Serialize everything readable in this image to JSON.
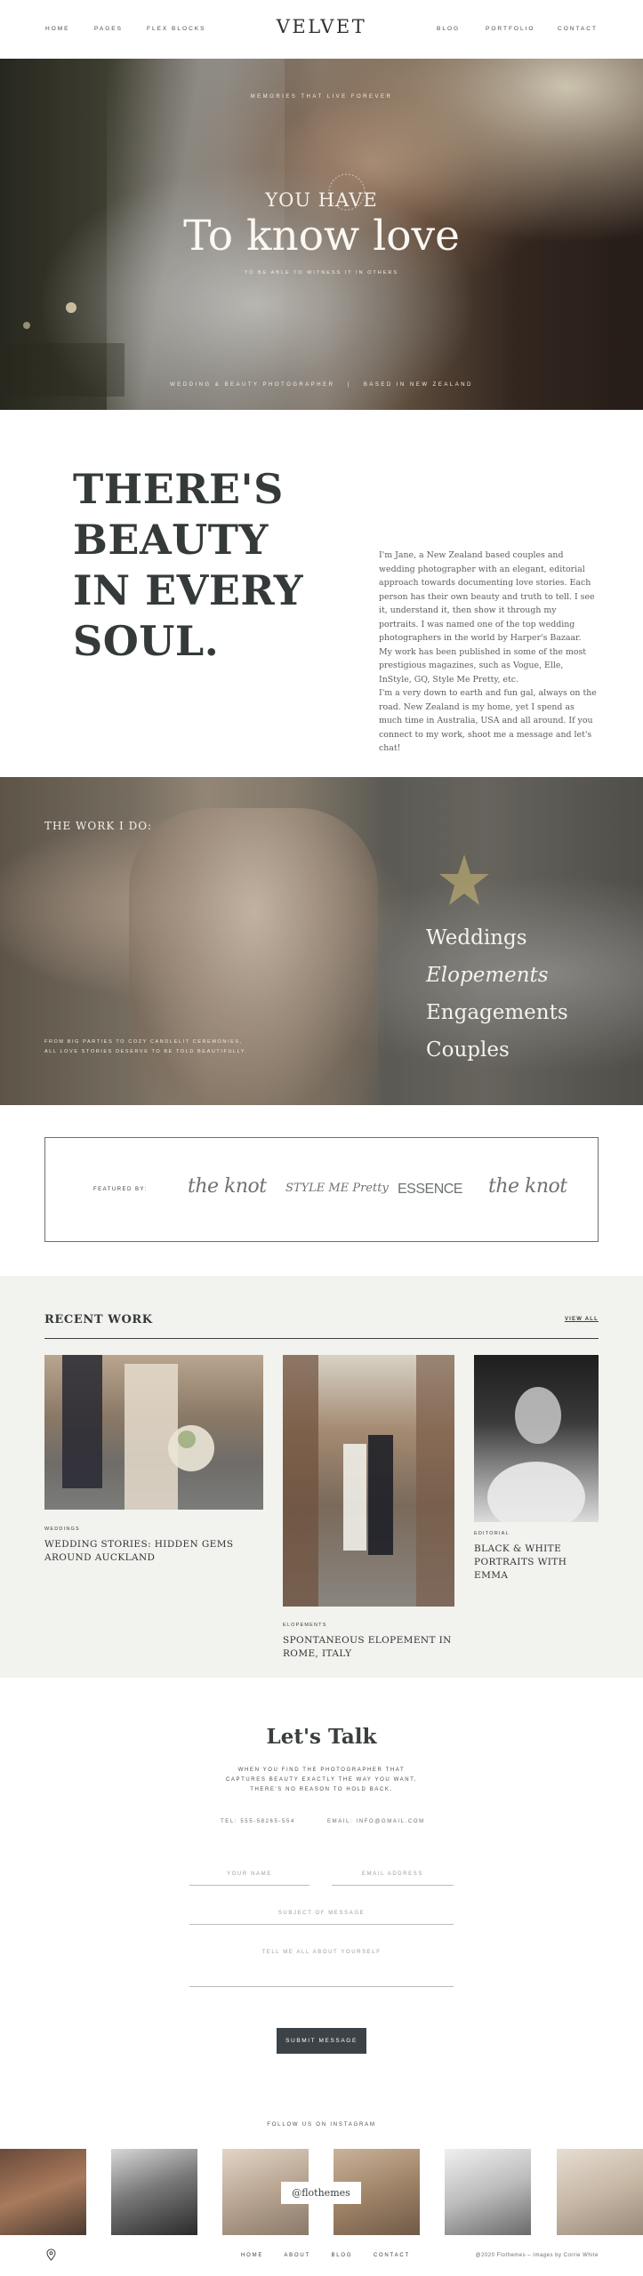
{
  "nav": {
    "left": [
      "HOME",
      "PAGES",
      "FLEX BLOCKS"
    ],
    "brand": "VELVET",
    "right": [
      "BLOG",
      "PORTFOLIO",
      "CONTACT"
    ]
  },
  "hero": {
    "kicker": "MEMORIES THAT LIVE FOREVER",
    "pre_title": "YOU HAVE",
    "title": "To know love",
    "subtitle": "TO BE ABLE TO WITNESS IT IN OTHERS",
    "footer_left": "WEDDING & BEAUTY PHOTOGRAPHER",
    "footer_sep": "|",
    "footer_right": "BASED IN NEW ZEALAND"
  },
  "intro": {
    "heading_lines": [
      "THERE'S",
      "BEAUTY",
      "IN EVERY",
      "SOUL."
    ],
    "paragraphs": [
      "I'm Jane, a New Zealand based couples and wedding photographer with an elegant, editorial approach towards documenting love stories. Each person has their own beauty and truth to tell. I see it, understand it, then show it through my portraits. I was named one of the top wedding photographers in the world by Harper's Bazaar. My work has been published in some of the most prestigious magazines, such as Vogue, Elle, InStyle, GQ, Style Me Pretty, etc.",
      "I'm a very down to earth and fun gal, always on the road. New Zealand is my home, yet I spend as much time in Australia, USA and all around. If you connect to my work, shoot me a message and let's chat!"
    ]
  },
  "work": {
    "title": "THE WORK I DO:",
    "services": [
      "Weddings",
      "Elopements",
      "Engagements",
      "Couples"
    ],
    "active_service": "Elopements",
    "footer_lines": [
      "FROM BIG PARTIES TO COZY CANDLELIT CEREMONIES,",
      "ALL LOVE STORIES DESERVE TO BE TOLD BEAUTIFULLY."
    ]
  },
  "featured": {
    "label": "FEATURED BY:",
    "logos": [
      "the knot",
      "STYLE ME Pretty",
      "ESSENCE",
      "the knot"
    ]
  },
  "recent": {
    "title": "RECENT WORK",
    "view_all": "VIEW ALL",
    "cards": [
      {
        "category": "WEDDINGS",
        "title": "WEDDING STORIES: HIDDEN GEMS AROUND AUCKLAND"
      },
      {
        "category": "ELOPEMENTS",
        "title": "SPONTANEOUS ELOPEMENT IN ROME, ITALY"
      },
      {
        "category": "EDITORIAL",
        "title": "BLACK & WHITE PORTRAITS WITH EMMA"
      }
    ]
  },
  "contact": {
    "title": "Let's Talk",
    "subtitle_lines": [
      "WHEN YOU FIND THE PHOTOGRAPHER THAT",
      "CAPTURES BEAUTY EXACTLY THE WAY YOU WANT,",
      "THERE'S NO REASON TO HOLD BACK."
    ],
    "phone": "TEL: 555-58265-554",
    "email": "EMAIL: INFO@GMAIL.COM",
    "name_placeholder": "YOUR NAME",
    "email_placeholder": "EMAIL ADDRESS",
    "subject_placeholder": "SUBJECT OF MESSAGE",
    "message_placeholder": "TELL ME ALL ABOUT YOURSELF",
    "submit": "SUBMIT MESSAGE"
  },
  "instagram": {
    "label": "FOLLOW US ON INSTAGRAM",
    "handle": "@flothemes"
  },
  "footer": {
    "links": [
      "HOME",
      "ABOUT",
      "BLOG",
      "CONTACT"
    ],
    "copyright": "@2020 Flothemes – Images by Corrie White"
  },
  "colors": {
    "ink": "#2f3334",
    "recent_bg": "#f2f2ee",
    "button": "#3b4348"
  }
}
